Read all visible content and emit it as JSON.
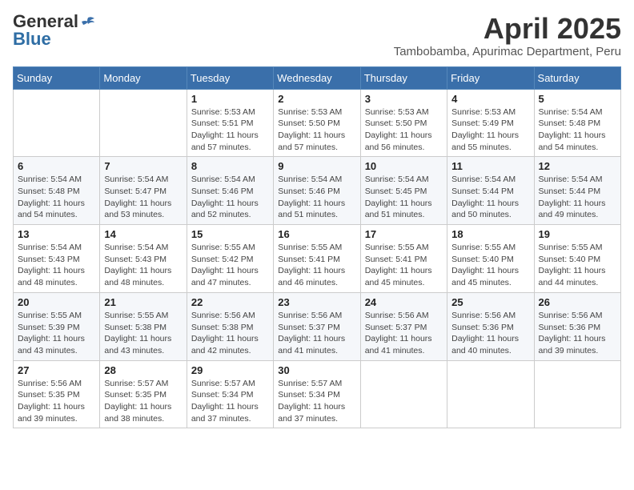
{
  "header": {
    "logo_general": "General",
    "logo_blue": "Blue",
    "month_title": "April 2025",
    "location": "Tambobamba, Apurimac Department, Peru"
  },
  "calendar": {
    "days_of_week": [
      "Sunday",
      "Monday",
      "Tuesday",
      "Wednesday",
      "Thursday",
      "Friday",
      "Saturday"
    ],
    "weeks": [
      [
        {
          "day": "",
          "info": ""
        },
        {
          "day": "",
          "info": ""
        },
        {
          "day": "1",
          "info": "Sunrise: 5:53 AM\nSunset: 5:51 PM\nDaylight: 11 hours and 57 minutes."
        },
        {
          "day": "2",
          "info": "Sunrise: 5:53 AM\nSunset: 5:50 PM\nDaylight: 11 hours and 57 minutes."
        },
        {
          "day": "3",
          "info": "Sunrise: 5:53 AM\nSunset: 5:50 PM\nDaylight: 11 hours and 56 minutes."
        },
        {
          "day": "4",
          "info": "Sunrise: 5:53 AM\nSunset: 5:49 PM\nDaylight: 11 hours and 55 minutes."
        },
        {
          "day": "5",
          "info": "Sunrise: 5:54 AM\nSunset: 5:48 PM\nDaylight: 11 hours and 54 minutes."
        }
      ],
      [
        {
          "day": "6",
          "info": "Sunrise: 5:54 AM\nSunset: 5:48 PM\nDaylight: 11 hours and 54 minutes."
        },
        {
          "day": "7",
          "info": "Sunrise: 5:54 AM\nSunset: 5:47 PM\nDaylight: 11 hours and 53 minutes."
        },
        {
          "day": "8",
          "info": "Sunrise: 5:54 AM\nSunset: 5:46 PM\nDaylight: 11 hours and 52 minutes."
        },
        {
          "day": "9",
          "info": "Sunrise: 5:54 AM\nSunset: 5:46 PM\nDaylight: 11 hours and 51 minutes."
        },
        {
          "day": "10",
          "info": "Sunrise: 5:54 AM\nSunset: 5:45 PM\nDaylight: 11 hours and 51 minutes."
        },
        {
          "day": "11",
          "info": "Sunrise: 5:54 AM\nSunset: 5:44 PM\nDaylight: 11 hours and 50 minutes."
        },
        {
          "day": "12",
          "info": "Sunrise: 5:54 AM\nSunset: 5:44 PM\nDaylight: 11 hours and 49 minutes."
        }
      ],
      [
        {
          "day": "13",
          "info": "Sunrise: 5:54 AM\nSunset: 5:43 PM\nDaylight: 11 hours and 48 minutes."
        },
        {
          "day": "14",
          "info": "Sunrise: 5:54 AM\nSunset: 5:43 PM\nDaylight: 11 hours and 48 minutes."
        },
        {
          "day": "15",
          "info": "Sunrise: 5:55 AM\nSunset: 5:42 PM\nDaylight: 11 hours and 47 minutes."
        },
        {
          "day": "16",
          "info": "Sunrise: 5:55 AM\nSunset: 5:41 PM\nDaylight: 11 hours and 46 minutes."
        },
        {
          "day": "17",
          "info": "Sunrise: 5:55 AM\nSunset: 5:41 PM\nDaylight: 11 hours and 45 minutes."
        },
        {
          "day": "18",
          "info": "Sunrise: 5:55 AM\nSunset: 5:40 PM\nDaylight: 11 hours and 45 minutes."
        },
        {
          "day": "19",
          "info": "Sunrise: 5:55 AM\nSunset: 5:40 PM\nDaylight: 11 hours and 44 minutes."
        }
      ],
      [
        {
          "day": "20",
          "info": "Sunrise: 5:55 AM\nSunset: 5:39 PM\nDaylight: 11 hours and 43 minutes."
        },
        {
          "day": "21",
          "info": "Sunrise: 5:55 AM\nSunset: 5:38 PM\nDaylight: 11 hours and 43 minutes."
        },
        {
          "day": "22",
          "info": "Sunrise: 5:56 AM\nSunset: 5:38 PM\nDaylight: 11 hours and 42 minutes."
        },
        {
          "day": "23",
          "info": "Sunrise: 5:56 AM\nSunset: 5:37 PM\nDaylight: 11 hours and 41 minutes."
        },
        {
          "day": "24",
          "info": "Sunrise: 5:56 AM\nSunset: 5:37 PM\nDaylight: 11 hours and 41 minutes."
        },
        {
          "day": "25",
          "info": "Sunrise: 5:56 AM\nSunset: 5:36 PM\nDaylight: 11 hours and 40 minutes."
        },
        {
          "day": "26",
          "info": "Sunrise: 5:56 AM\nSunset: 5:36 PM\nDaylight: 11 hours and 39 minutes."
        }
      ],
      [
        {
          "day": "27",
          "info": "Sunrise: 5:56 AM\nSunset: 5:35 PM\nDaylight: 11 hours and 39 minutes."
        },
        {
          "day": "28",
          "info": "Sunrise: 5:57 AM\nSunset: 5:35 PM\nDaylight: 11 hours and 38 minutes."
        },
        {
          "day": "29",
          "info": "Sunrise: 5:57 AM\nSunset: 5:34 PM\nDaylight: 11 hours and 37 minutes."
        },
        {
          "day": "30",
          "info": "Sunrise: 5:57 AM\nSunset: 5:34 PM\nDaylight: 11 hours and 37 minutes."
        },
        {
          "day": "",
          "info": ""
        },
        {
          "day": "",
          "info": ""
        },
        {
          "day": "",
          "info": ""
        }
      ]
    ]
  }
}
